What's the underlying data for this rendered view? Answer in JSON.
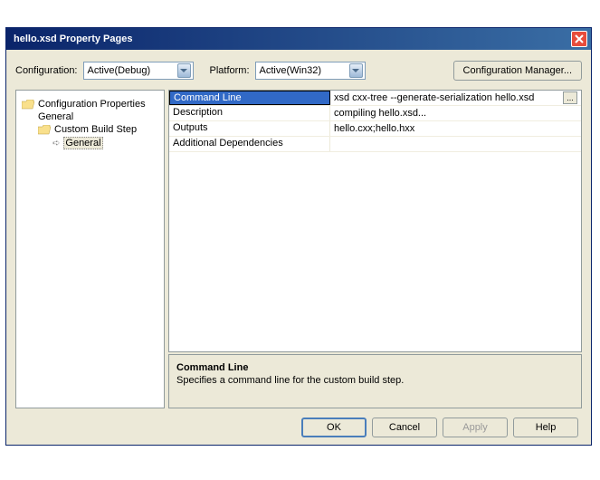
{
  "titlebar": {
    "title": "hello.xsd Property Pages"
  },
  "config": {
    "configuration_label": "Configuration:",
    "configuration_value": "Active(Debug)",
    "platform_label": "Platform:",
    "platform_value": "Active(Win32)",
    "manager_button": "Configuration Manager..."
  },
  "tree": {
    "items": [
      {
        "label": "Configuration Properties"
      },
      {
        "label": "General"
      },
      {
        "label": "Custom Build Step"
      },
      {
        "label": "General"
      }
    ]
  },
  "grid": {
    "rows": [
      {
        "name": "Command Line",
        "value": "xsd cxx-tree --generate-serialization hello.xsd",
        "selected": true,
        "ellipsis": true
      },
      {
        "name": "Description",
        "value": "compiling hello.xsd..."
      },
      {
        "name": "Outputs",
        "value": "hello.cxx;hello.hxx"
      },
      {
        "name": "Additional Dependencies",
        "value": ""
      }
    ]
  },
  "description": {
    "title": "Command Line",
    "text": "Specifies a command line for the custom build step."
  },
  "buttons": {
    "ok": "OK",
    "cancel": "Cancel",
    "apply": "Apply",
    "help": "Help"
  }
}
